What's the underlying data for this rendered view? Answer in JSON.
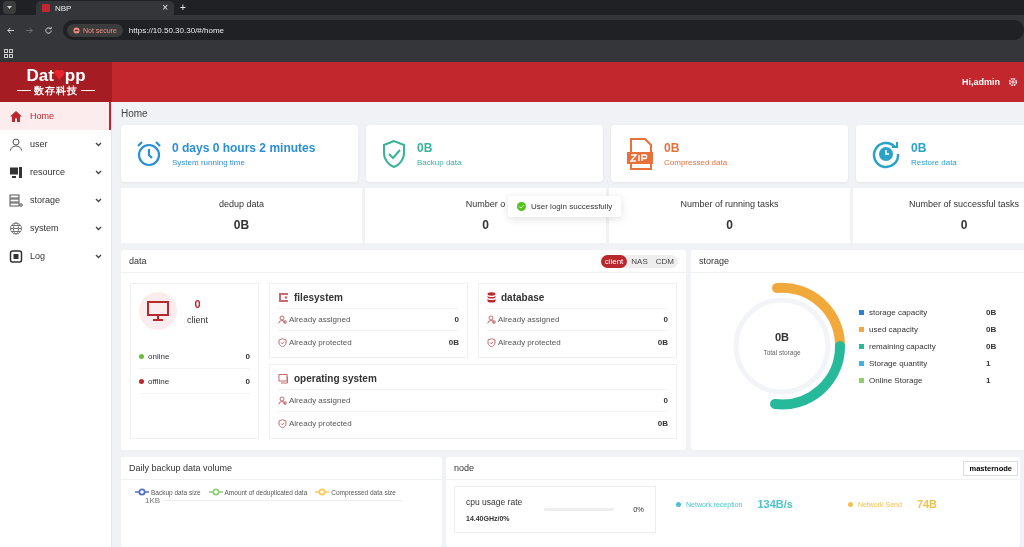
{
  "browser": {
    "tab_title": "NBP",
    "tab_close": "×",
    "new_tab": "+",
    "security": "Not secure",
    "url": "https://10.50.30.30/#/home"
  },
  "header": {
    "logo_start": "Dat",
    "logo_end": "pp",
    "logo_subtitle": "数存科技",
    "greeting": "Hi,admin"
  },
  "sidebar": [
    {
      "kind": "home",
      "label": "Home",
      "selected": true,
      "expandable": false
    },
    {
      "kind": "user",
      "label": "user",
      "selected": false,
      "expandable": true
    },
    {
      "kind": "resource",
      "label": "resource",
      "selected": false,
      "expandable": true
    },
    {
      "kind": "storage",
      "label": "storage",
      "selected": false,
      "expandable": true
    },
    {
      "kind": "system",
      "label": "system",
      "selected": false,
      "expandable": true
    },
    {
      "kind": "log",
      "label": "Log",
      "selected": false,
      "expandable": true
    }
  ],
  "breadcrumb": "Home",
  "summary_cards": [
    {
      "kind": "clock",
      "value": "0 days 0 hours 2 minutes",
      "label": "System running time",
      "color": "#2b8fd6"
    },
    {
      "kind": "shield",
      "value": "0B",
      "label": "Backup data",
      "color": "#3bb39a"
    },
    {
      "kind": "zip",
      "value": "0B",
      "label": "Compressed data",
      "color": "#e8703a"
    },
    {
      "kind": "restore",
      "value": "0B",
      "label": "Restore data",
      "color": "#2ba3c8"
    }
  ],
  "counters": [
    {
      "label": "dedup data",
      "value": "0B"
    },
    {
      "label": "Number o",
      "value": "0"
    },
    {
      "label": "Number of running tasks",
      "value": "0"
    },
    {
      "label": "Number of successful tasks",
      "value": "0"
    }
  ],
  "toast": {
    "message": "User login successfully"
  },
  "data_panel": {
    "title": "data",
    "tabs": [
      {
        "label": "client",
        "selected": true
      },
      {
        "label": "NAS",
        "selected": false
      },
      {
        "label": "CDM",
        "selected": false
      }
    ],
    "client": {
      "count": "0",
      "label": "client",
      "statuses": [
        {
          "label": "online",
          "value": "0",
          "color": "#67c23a"
        },
        {
          "label": "offline",
          "value": "0",
          "color": "#c0272d"
        }
      ]
    },
    "groups": [
      {
        "kind": "filesystem",
        "title": "filesystem",
        "rows": [
          {
            "kind": "assigned",
            "label": "Already assigned",
            "value": "0"
          },
          {
            "kind": "protected",
            "label": "Already protected",
            "value": "0B"
          }
        ]
      },
      {
        "kind": "database",
        "title": "database",
        "rows": [
          {
            "kind": "assigned",
            "label": "Already assigned",
            "value": "0"
          },
          {
            "kind": "protected",
            "label": "Already protected",
            "value": "0B"
          }
        ]
      },
      {
        "kind": "os",
        "title": "operating system",
        "rows": [
          {
            "kind": "assigned",
            "label": "Already assigned",
            "value": "0"
          },
          {
            "kind": "protected",
            "label": "Already protected",
            "value": "0B"
          }
        ]
      }
    ]
  },
  "storage_panel": {
    "title": "storage",
    "total_value": "0B",
    "total_label": "Total storage",
    "legend": [
      {
        "label": "storage capacity",
        "value": "0B",
        "color": "#2d7fd6"
      },
      {
        "label": "used capacity",
        "value": "0B",
        "color": "#f2a93b"
      },
      {
        "label": "remaining capacity",
        "value": "0B",
        "color": "#26b99a"
      },
      {
        "label": "Storage quantity",
        "value": "1",
        "color": "#3fb1e3"
      },
      {
        "label": "Online Storage",
        "value": "1",
        "color": "#8fcf6b"
      }
    ]
  },
  "daily_backup": {
    "title": "Daily backup data volume",
    "legend": [
      {
        "label": "Backup data size",
        "color": "#5470c6"
      },
      {
        "label": "Amount of deduplicated data",
        "color": "#91cc75"
      },
      {
        "label": "Compressed data size",
        "color": "#fac858"
      }
    ],
    "axis_label": "1KB"
  },
  "node": {
    "title": "node",
    "selector": "masternode",
    "cpu": {
      "title": "cpu usage rate",
      "detail": "14.40GHz/0%",
      "level": 0,
      "reading": "0%"
    },
    "network": [
      {
        "label": "Network reception",
        "value": "134B/s",
        "color": "#4ec3c9"
      },
      {
        "label": "Network Send",
        "value": "74B",
        "color": "#f2c14e"
      }
    ]
  }
}
